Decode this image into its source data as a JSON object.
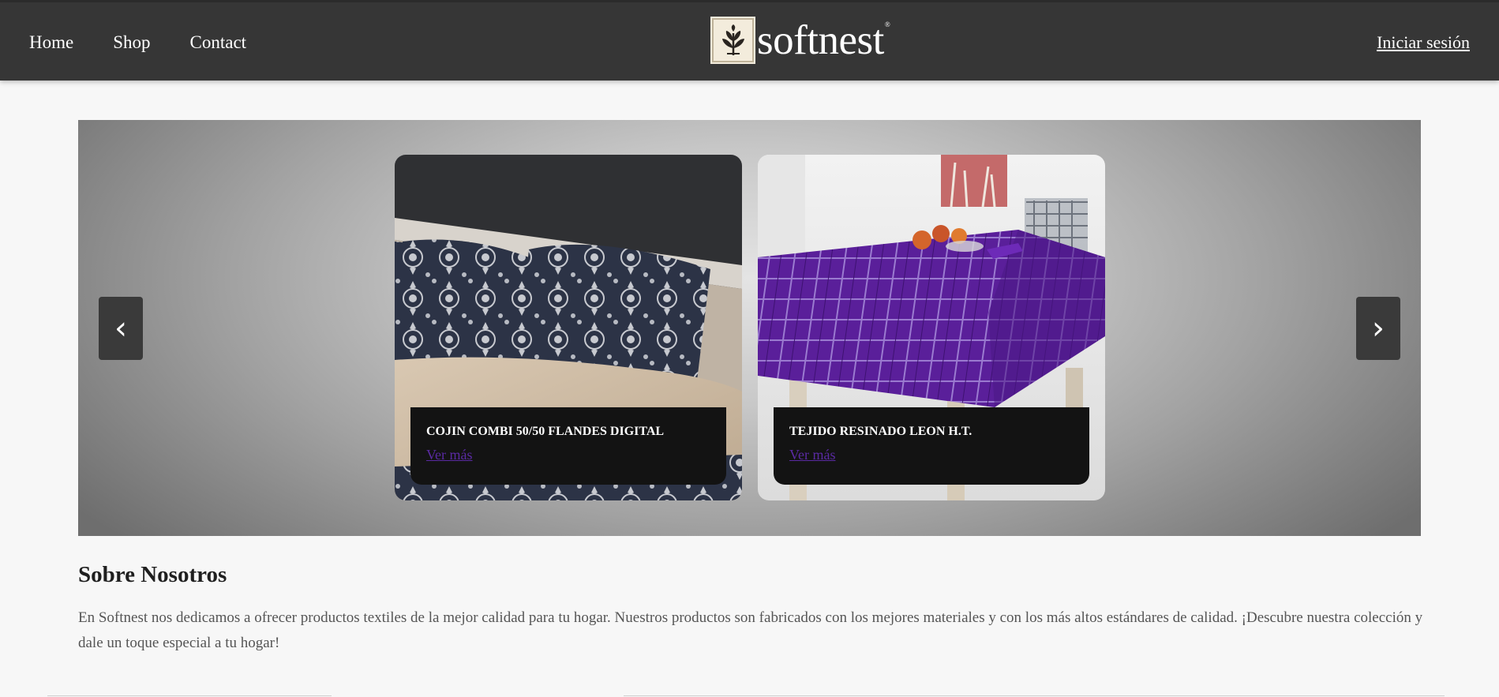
{
  "nav": {
    "links": [
      "Home",
      "Shop",
      "Contact"
    ],
    "logo_text": "softnest",
    "logo_reg": "®",
    "login": "Iniciar sesión"
  },
  "carousel": {
    "prev_icon": "‹",
    "next_icon": "›",
    "cards": [
      {
        "title": "COJIN COMBI 50/50 FLANDES DIGITAL",
        "link": "Ver más",
        "image": "navy-damask-cushions-photo"
      },
      {
        "title": "TEJIDO RESINADO LEON H.T.",
        "link": "Ver más",
        "image": "purple-plaid-tablecloth-photo"
      }
    ]
  },
  "about": {
    "title": "Sobre Nosotros",
    "text": "En Softnest nos dedicamos a ofrecer productos textiles de la mejor calidad para tu hogar. Nuestros productos son fabricados con los mejores materiales y con los más altos estándares de calidad. ¡Descubre nuestra colección y dale un toque especial a tu hogar!"
  },
  "colors": {
    "navbar": "#363636",
    "link_visited": "#5a2aa3",
    "caption_bg": "#131313"
  }
}
